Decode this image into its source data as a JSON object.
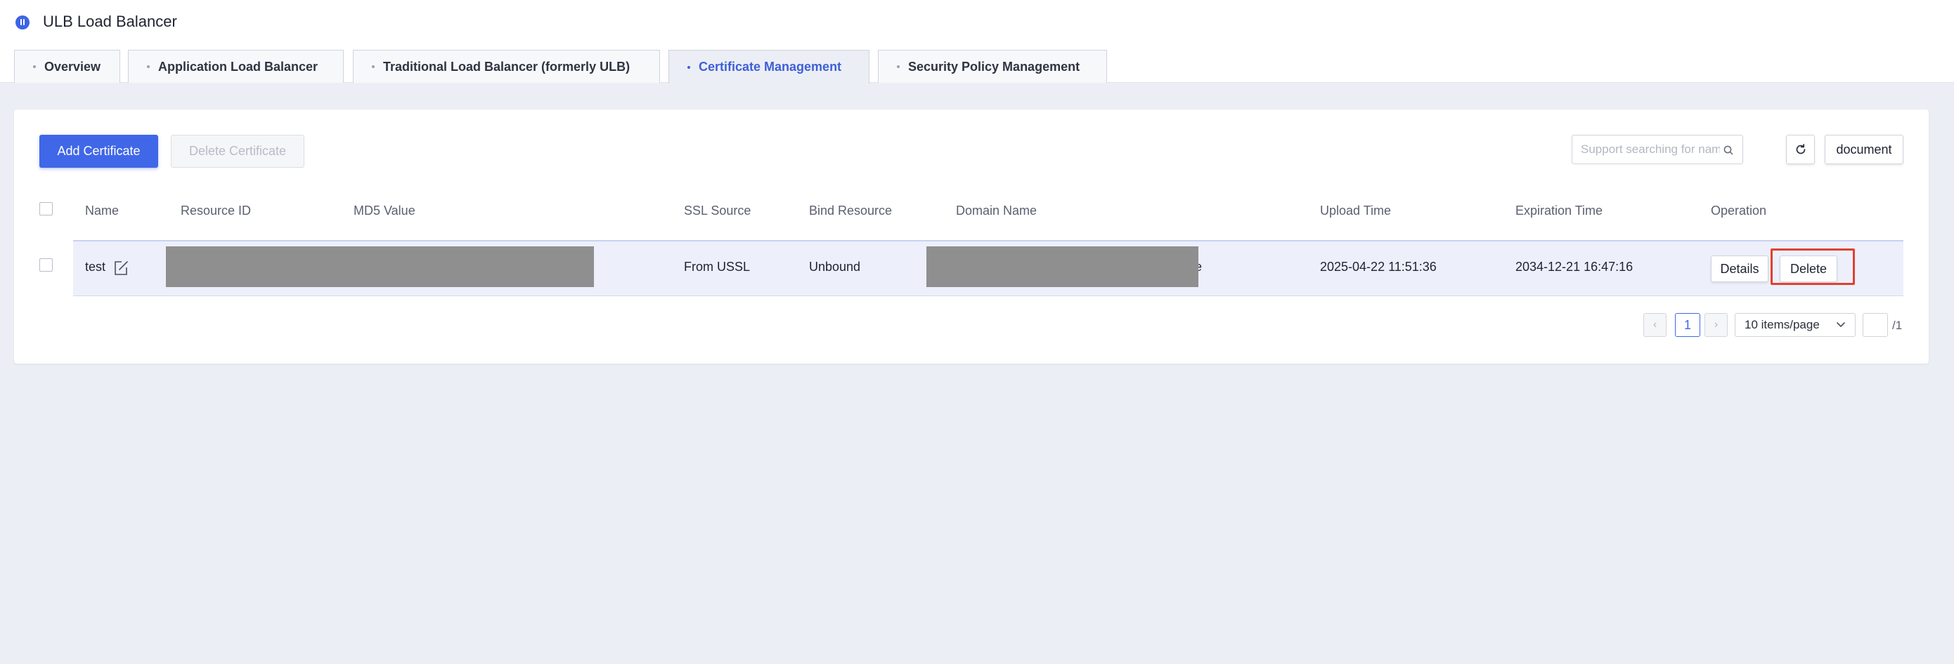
{
  "app": {
    "title": "ULB Load Balancer"
  },
  "tabs": [
    {
      "label": "Overview"
    },
    {
      "label": "Application Load Balancer"
    },
    {
      "label": "Traditional Load Balancer (formerly ULB)"
    },
    {
      "label": "Certificate Management",
      "active": true
    },
    {
      "label": "Security Policy Management"
    }
  ],
  "toolbar": {
    "add_label": "Add Certificate",
    "delete_label": "Delete Certificate",
    "search_placeholder": "Support searching for nam",
    "document_label": "document"
  },
  "table": {
    "columns": [
      "Name",
      "Resource ID",
      "MD5 Value",
      "SSL Source",
      "Bind Resource",
      "Domain Name",
      "Upload Time",
      "Expiration Time",
      "Operation"
    ],
    "rows": [
      {
        "name": "test",
        "ssl_source": "From USSL",
        "bind_resource": "Unbound",
        "domain_suffix": "e",
        "upload_time": "2025-04-22 11:51:36",
        "expiration_time": "2034-12-21 16:47:16",
        "details_label": "Details",
        "delete_label": "Delete"
      }
    ]
  },
  "pagination": {
    "prev": "‹",
    "next": "›",
    "current_page": "1",
    "page_size": "10 items/page",
    "total_pages": "/1"
  },
  "colors": {
    "accent": "#4067e8",
    "active_tab_text": "#3d5fd8",
    "highlight_box": "#e2402f",
    "row_selected_bg": "#edf0fb",
    "page_bg": "#eceef5"
  },
  "icons": [
    "logo-icon",
    "edit-icon",
    "search-icon",
    "refresh-icon",
    "chevron-down-icon"
  ]
}
